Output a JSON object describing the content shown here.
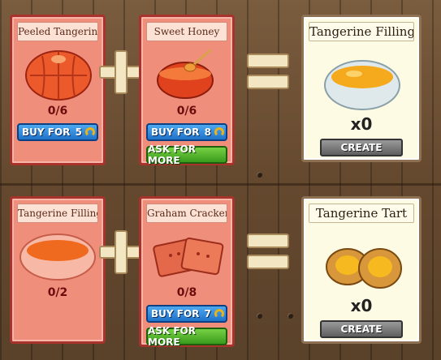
{
  "recipes": [
    {
      "ingredients": [
        {
          "name": "Peeled Tangerine",
          "count": "0/6",
          "buy_label": "BUY FOR",
          "buy_price": "5"
        },
        {
          "name": "Sweet Honey",
          "count": "0/6",
          "buy_label": "BUY FOR",
          "buy_price": "8",
          "ask_label": "ASK FOR MORE"
        }
      ],
      "result": {
        "name": "Tangerine Filling",
        "count": "x0",
        "create_label": "CREATE"
      }
    },
    {
      "ingredients": [
        {
          "name": "Tangerine Filling",
          "count": "0/2"
        },
        {
          "name": "Graham Cracker",
          "count": "0/8",
          "buy_label": "BUY FOR",
          "buy_price": "7",
          "ask_label": "ASK FOR MORE"
        }
      ],
      "result": {
        "name": "Tangerine Tart",
        "count": "x0",
        "create_label": "CREATE"
      }
    }
  ],
  "colors": {
    "ingredient_card": "#f08e7c",
    "result_card": "#fdfbe4",
    "buy_button": "#2f8ee0",
    "ask_button": "#56b52e",
    "create_button": "#7a7a7a"
  },
  "icons": {
    "currency": "horseshoe-icon",
    "plus": "plus-icon",
    "equals": "equals-icon"
  }
}
